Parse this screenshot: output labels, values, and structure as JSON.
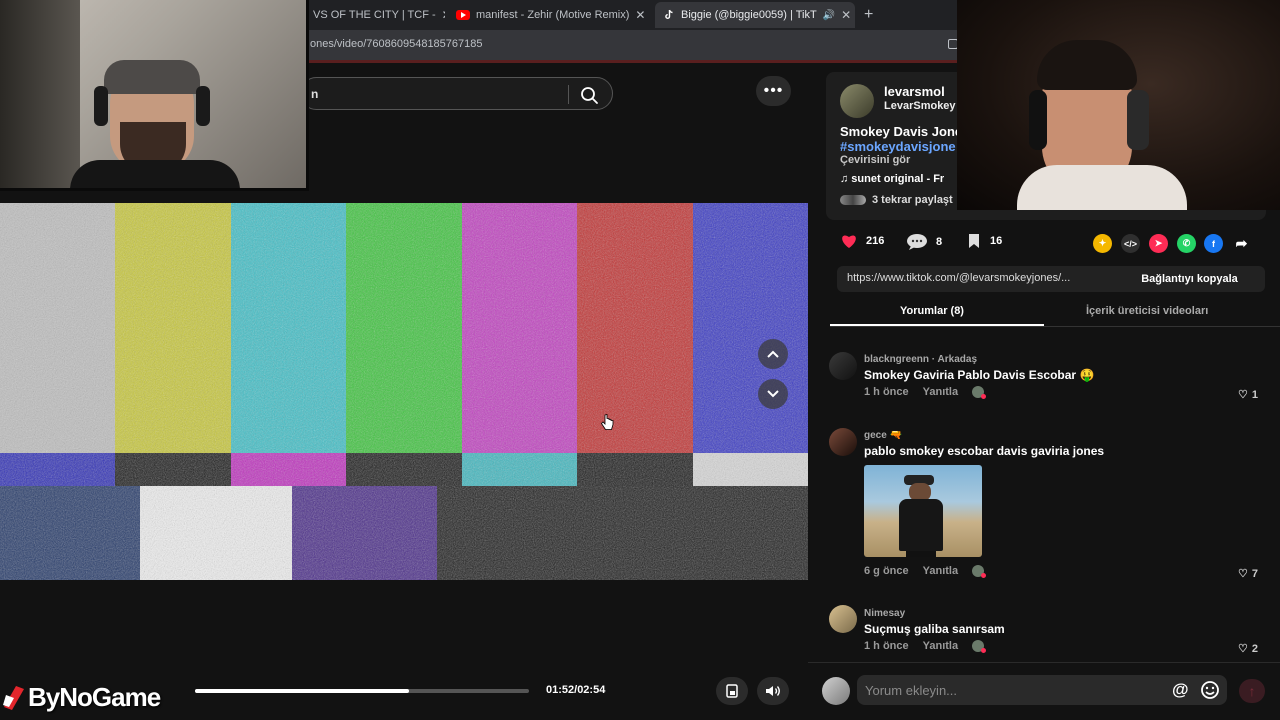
{
  "browser": {
    "tabs": [
      {
        "title": "VS OF THE CITY | TCF -",
        "active": false
      },
      {
        "title": "manifest - Zehir (Motive Remix)",
        "active": false,
        "icon": "youtube-icon"
      },
      {
        "title": "Biggie (@biggie0059) | TikT",
        "active": true,
        "icon": "tiktok-icon"
      }
    ],
    "new_tab": "+",
    "url": "ones/video/7608609548185767185"
  },
  "search": {
    "text": "n"
  },
  "more_label": "•••",
  "video": {
    "bars_top": [
      "#bfbfbf",
      "#c9c93a",
      "#3fc0c8",
      "#3ec63e",
      "#c23fc2",
      "#c33232",
      "#3a3ac6"
    ],
    "bars_mid": [
      "#3030b8",
      "#1c1c1c",
      "#c030c0",
      "#1c1c1c",
      "#3fb8c0",
      "#1c1c1c",
      "#d8d8d8"
    ],
    "bars_bot": [
      "#253a6a",
      "#f0f0f0",
      "#4a2c8a",
      "#1f1f1f",
      "#1f1f1f",
      "#1f1f1f"
    ]
  },
  "player": {
    "time": "01:52/02:54",
    "progress": 0.64
  },
  "post": {
    "username": "levarsmol",
    "handle": "LevarSmokey",
    "description": "Smokey Davis Jone",
    "hashtag": "#smokeydavisjone",
    "translate": "Çevirisini gör",
    "music": "♫  sunet original - Fr",
    "reposts": "3 tekrar paylaşt",
    "likes": "216",
    "comments": "8",
    "saves": "16",
    "link": "https://www.tiktok.com/@levarsmokeyjones/...",
    "copy_label": "Bağlantıyı kopyala",
    "share_colors": {
      "coin": "#f5b800",
      "embed": "#2f2f2f",
      "send": "#fe2c55",
      "whatsapp": "#25d366",
      "facebook": "#1877f2"
    }
  },
  "tabs": {
    "comments": "Yorumlar (8)",
    "creator": "İçerik üreticisi videoları"
  },
  "comments": [
    {
      "name": "blackngreenn · Arkadaş",
      "text": "Smokey Gaviria Pablo Davis Escobar 🤑",
      "time": "1 h önce",
      "reply": "Yanıtla",
      "likes": "1"
    },
    {
      "name": "gece 🔫",
      "text": "pablo smokey escobar davis gaviria jones",
      "time": "6 g önce",
      "reply": "Yanıtla",
      "likes": "7"
    },
    {
      "name": "Nimesay",
      "text": "Suçmuş galiba sanırsam",
      "time": "1 h önce",
      "reply": "Yanıtla",
      "likes": "2"
    }
  ],
  "comment_input": {
    "placeholder": "Yorum ekleyin..."
  },
  "watermark": {
    "text": "ByNoGame"
  },
  "colors": {
    "accent": "#fe2c55",
    "link": "#6ba6ff"
  }
}
